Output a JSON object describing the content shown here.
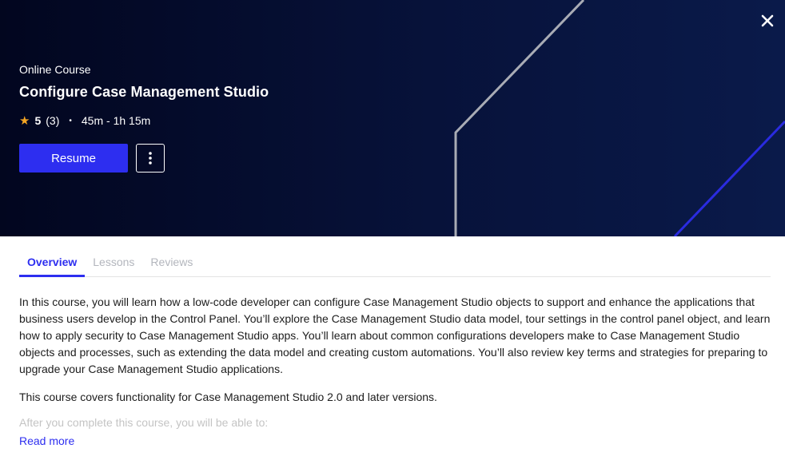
{
  "hero": {
    "eyebrow": "Online Course",
    "title": "Configure Case Management Studio",
    "rating": "5",
    "rating_count": "(3)",
    "duration": "45m - 1h 15m",
    "resume_label": "Resume"
  },
  "icons": {
    "close": "close-icon",
    "star": "star-icon",
    "more": "more-vertical-icon"
  },
  "tabs": [
    {
      "label": "Overview",
      "active": true
    },
    {
      "label": "Lessons",
      "active": false
    },
    {
      "label": "Reviews",
      "active": false
    }
  ],
  "overview": {
    "paragraph_1": "In this course, you will learn how a low-code developer can configure Case Management Studio objects to support and enhance the applications that business users develop in the Control Panel. You’ll explore the Case Management Studio data model, tour settings in the control panel object, and learn how to apply security to Case Management Studio apps. You’ll learn about common configurations developers make to Case Management Studio objects and processes, such as extending the data model and creating custom automations. You’ll also review key terms and strategies for preparing to upgrade your Case Management Studio applications.",
    "paragraph_2": "This course covers functionality for Case Management Studio 2.0 and later versions.",
    "paragraph_3": "After you complete this course, you will be able to:",
    "read_more": "Read more"
  },
  "colors": {
    "accent": "#2d2ef0",
    "hero_bg": "#07123a",
    "star": "#f5a623"
  }
}
